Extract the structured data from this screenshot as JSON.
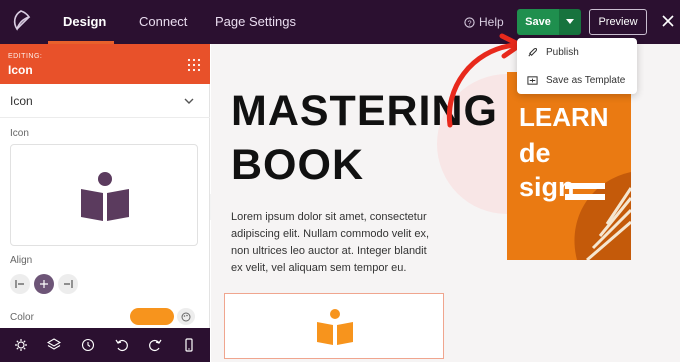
{
  "topbar": {
    "tabs": [
      {
        "label": "Design",
        "active": true
      },
      {
        "label": "Connect",
        "active": false
      },
      {
        "label": "Page Settings",
        "active": false
      }
    ],
    "help_label": "Help",
    "save_label": "Save",
    "preview_label": "Preview"
  },
  "dropdown": {
    "items": [
      {
        "label": "Publish",
        "icon": "rocket-icon"
      },
      {
        "label": "Save as Template",
        "icon": "template-icon"
      }
    ]
  },
  "sidebar": {
    "editing_small": "EDITING:",
    "editing_title": "Icon",
    "section_title": "Icon",
    "icon_label": "Icon",
    "align_label": "Align",
    "color_label": "Color",
    "color_value": "#f7941d",
    "bottom_icons": [
      "settings-icon",
      "layers-icon",
      "history-icon",
      "undo-icon",
      "redo-icon",
      "mobile-icon"
    ]
  },
  "canvas": {
    "headline_line1": "MASTERING",
    "headline_line2": "BOOK",
    "body": "Lorem ipsum dolor sit amet, consectetur adipiscing elit. Nullam commodo velit ex, non ultrices leo auctor at. Integer blandit ex velit, vel aliquam sem tempor eu.",
    "cover_line1": "LEARN",
    "cover_line2": "de",
    "cover_line3": "sign"
  },
  "colors": {
    "topbar": "#2b1030",
    "accent_orange": "#e8512a",
    "save_green": "#1f8f4e",
    "icon_orange": "#f7941d",
    "icon_purple": "#5b3b5e"
  }
}
